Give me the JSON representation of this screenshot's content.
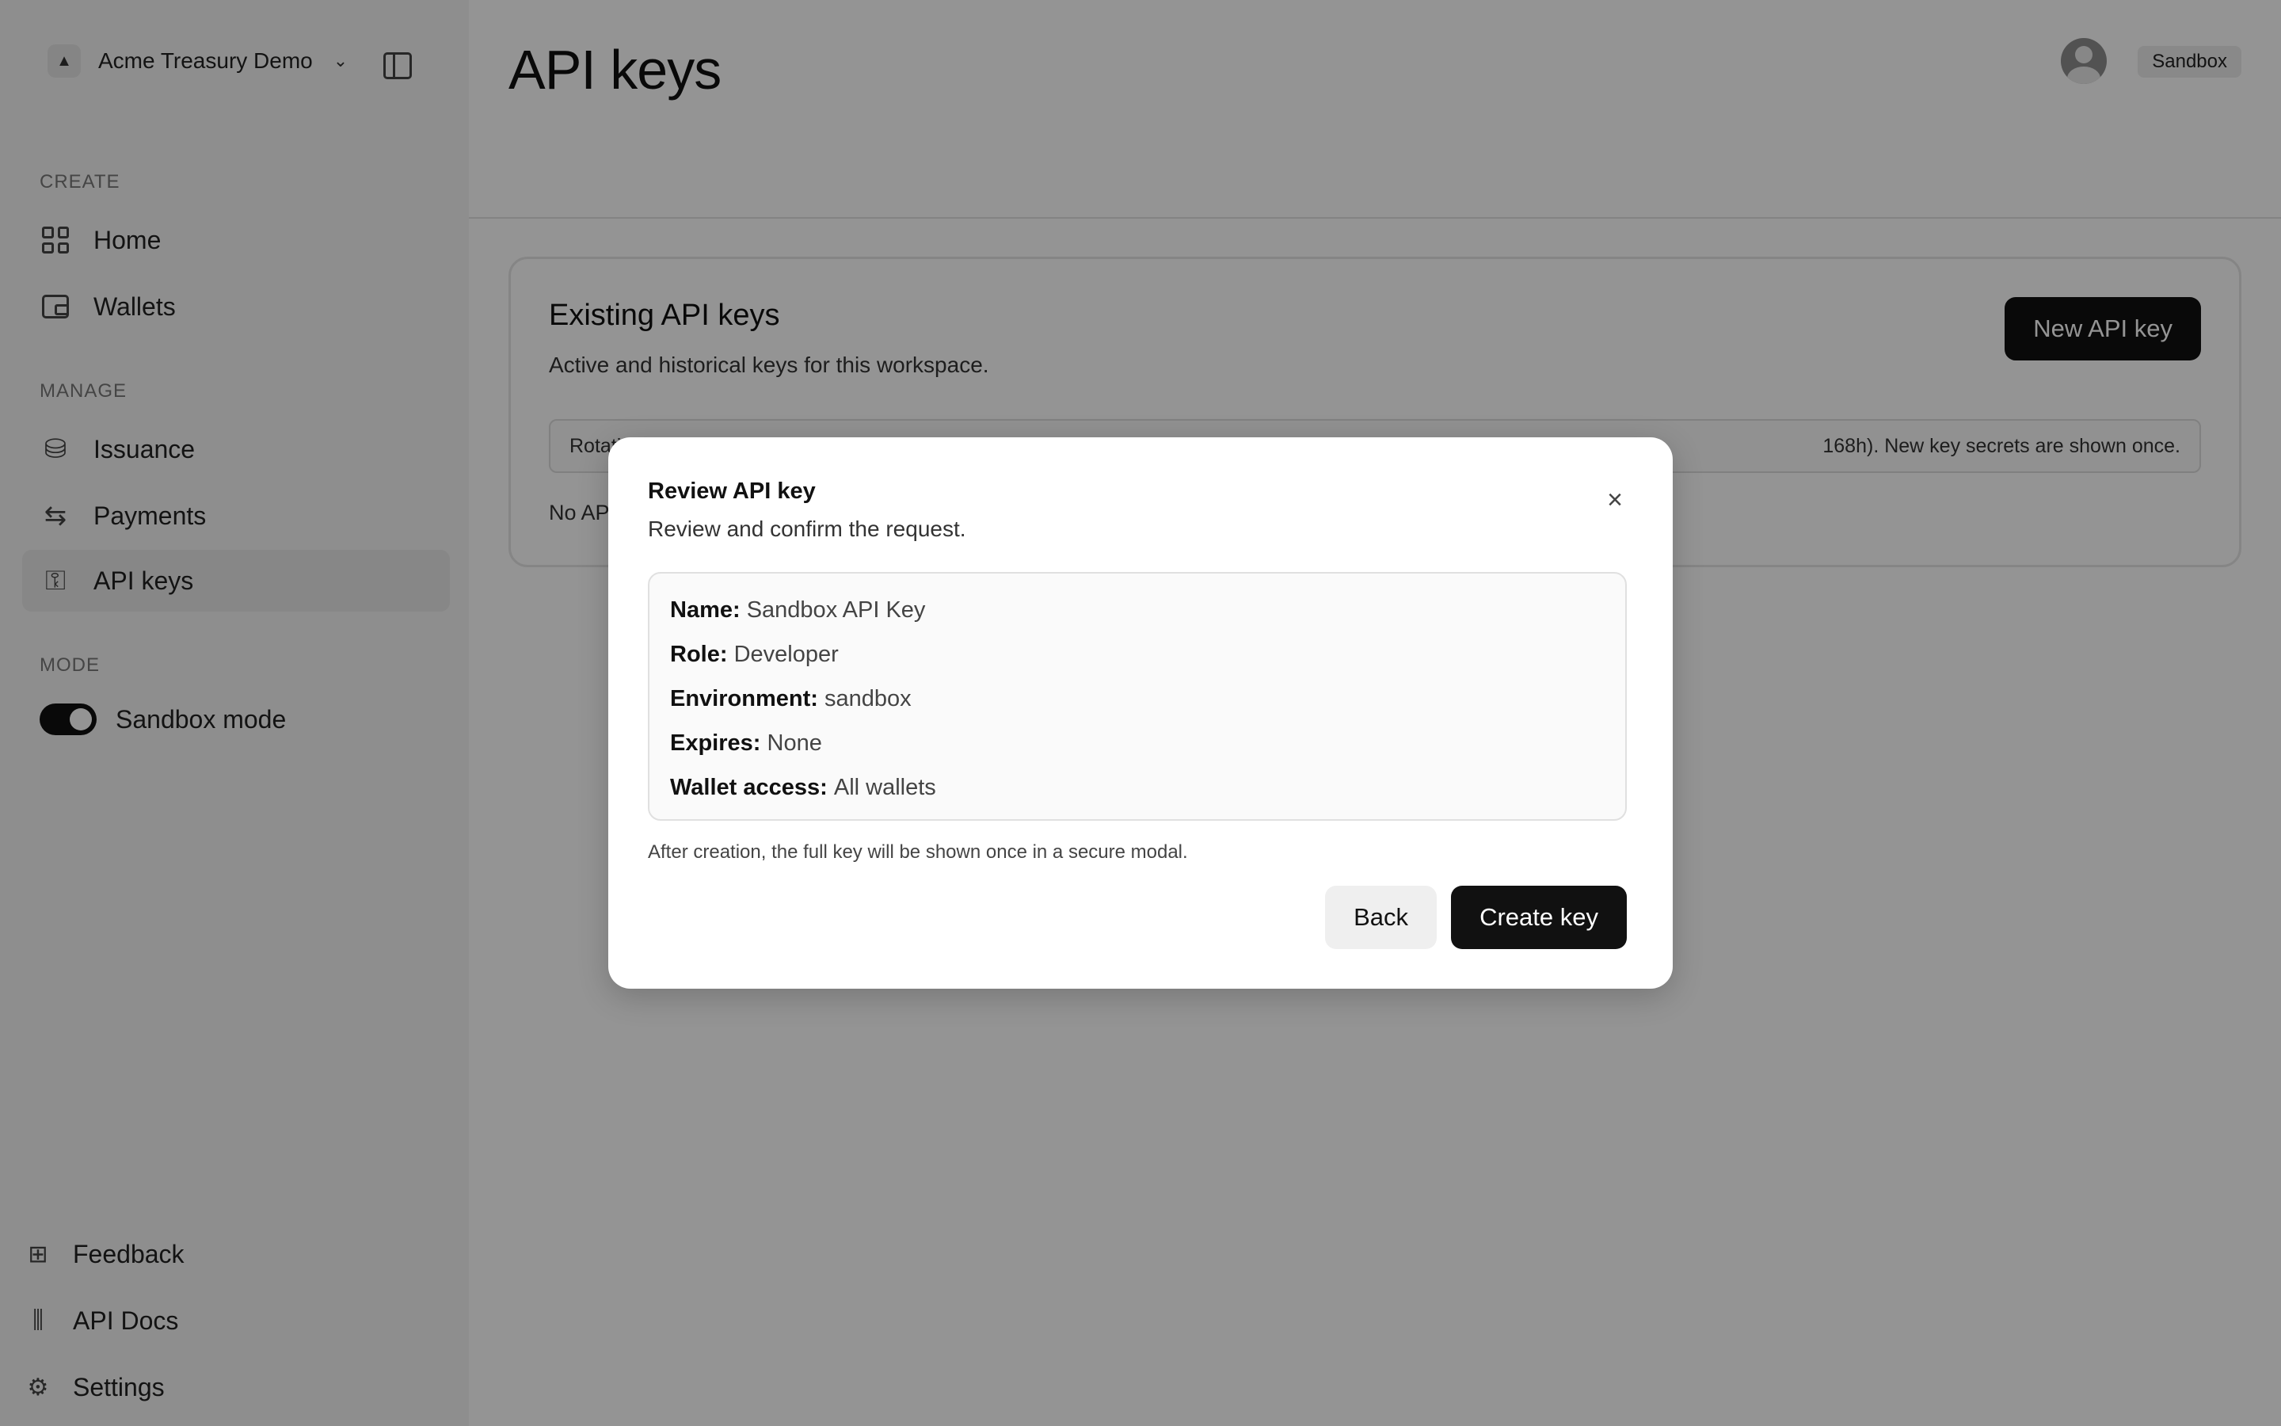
{
  "sidebar": {
    "workspace_name": "Acme Treasury Demo",
    "sections": {
      "create": "CREATE",
      "manage": "MANAGE",
      "mode": "MODE"
    },
    "items": {
      "home": "Home",
      "wallets": "Wallets",
      "issuance": "Issuance",
      "payments": "Payments",
      "api_keys": "API keys"
    },
    "mode_toggle": {
      "label": "Sandbox mode",
      "on": true
    },
    "bottom": {
      "feedback": "Feedback",
      "api_docs": "API Docs",
      "settings": "Settings"
    },
    "active_item": "API keys"
  },
  "header": {
    "title": "API keys",
    "environment_badge": "Sandbox"
  },
  "card": {
    "title": "Existing API keys",
    "subtitle": "Active and historical keys for this workspace.",
    "new_button": "New API key",
    "notice_left": "Rotati",
    "notice_right": "168h). New key secrets are shown once.",
    "empty_text": "No AP"
  },
  "modal": {
    "title": "Review API key",
    "subtitle": "Review and confirm the request.",
    "summary": [
      {
        "key": "Name:",
        "value": "Sandbox API Key"
      },
      {
        "key": "Role:",
        "value": "Developer"
      },
      {
        "key": "Environment:",
        "value": "sandbox"
      },
      {
        "key": "Expires:",
        "value": "None"
      },
      {
        "key": "Wallet access:",
        "value": "All wallets"
      }
    ],
    "note": "After creation, the full key will be shown once in a secure modal.",
    "back_button": "Back",
    "create_button": "Create key"
  },
  "icons": {
    "close": "close-icon",
    "chevron": "chevron-down-icon"
  }
}
